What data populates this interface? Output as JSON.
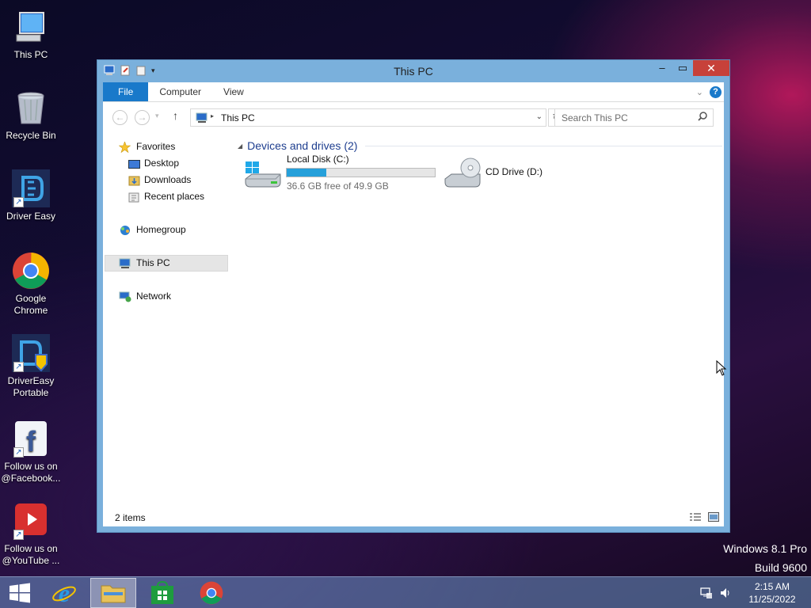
{
  "desktop": {
    "icons": [
      {
        "label": "This PC"
      },
      {
        "label": "Recycle Bin"
      },
      {
        "label": "Driver Easy"
      },
      {
        "label": "Google Chrome"
      },
      {
        "label": "DriverEasy Portable"
      },
      {
        "label": "Follow us on @Facebook..."
      },
      {
        "label": "Follow us on @YouTube ..."
      }
    ],
    "watermark": {
      "line1": "Windows 8.1 Pro",
      "line2": "Build 9600"
    }
  },
  "window": {
    "title": "This PC",
    "ribbon_tabs": {
      "file": "File",
      "computer": "Computer",
      "view": "View"
    },
    "address": {
      "path": "This PC"
    },
    "search": {
      "placeholder": "Search This PC"
    },
    "nav_pane": {
      "favorites": "Favorites",
      "desktop": "Desktop",
      "downloads": "Downloads",
      "recent": "Recent places",
      "homegroup": "Homegroup",
      "this_pc": "This PC",
      "network": "Network"
    },
    "content": {
      "group_label": "Devices and drives (2)",
      "drives": [
        {
          "name": "Local Disk (C:)",
          "free_text": "36.6 GB free of 49.9 GB",
          "used_fraction": 0.267
        },
        {
          "name": "CD Drive (D:)"
        }
      ]
    },
    "status": {
      "item_count": "2 items"
    }
  },
  "taskbar": {
    "clock": {
      "time": "2:15 AM",
      "date": "11/25/2022"
    }
  },
  "colors": {
    "accent": "#1979ca",
    "bar_fill": "#26a0da",
    "close": "#c7413a"
  }
}
